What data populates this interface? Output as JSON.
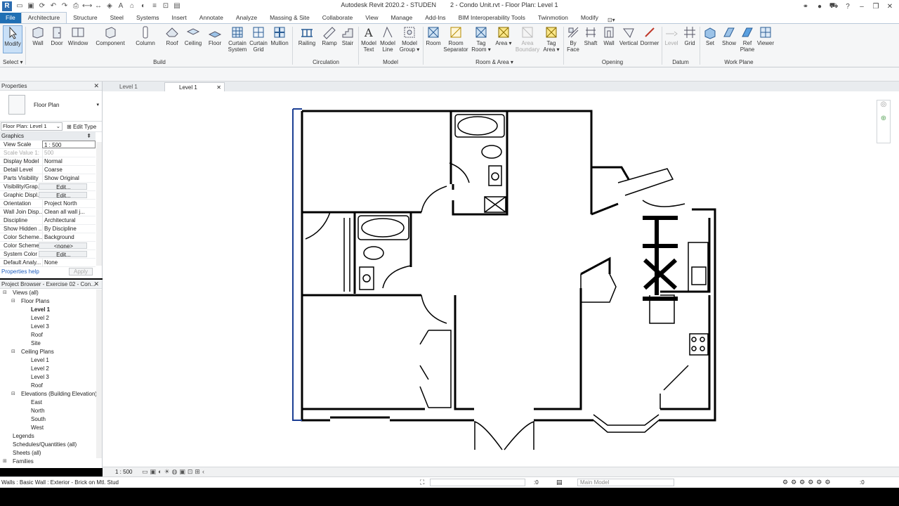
{
  "titlebar": {
    "title": "Autodesk Revit 2020.2 - STUDEN",
    "doc": "2 - Condo Unit.rvt - Floor Plan: Level 1",
    "app_letter": "R"
  },
  "ribbon_tabs": [
    "File",
    "Architecture",
    "Structure",
    "Steel",
    "Systems",
    "Insert",
    "Annotate",
    "Analyze",
    "Massing & Site",
    "Collaborate",
    "View",
    "Manage",
    "Add-Ins",
    "BIM Interoperability Tools",
    "Twinmotion",
    "Modify"
  ],
  "ribbon_active_tab": "Architecture",
  "tools": {
    "modify": "Modify",
    "wall": "Wall",
    "door": "Door",
    "window": "Window",
    "component": "Component",
    "column": "Column",
    "roof": "Roof",
    "ceiling": "Ceiling",
    "floor": "Floor",
    "curtain_system_1": "Curtain",
    "curtain_system_2": "System",
    "curtain_grid_1": "Curtain",
    "curtain_grid_2": "Grid",
    "mullion": "Mullion",
    "railing": "Railing",
    "ramp": "Ramp",
    "stair": "Stair",
    "model_text_1": "Model",
    "model_text_2": "Text",
    "model_line_1": "Model",
    "model_line_2": "Line",
    "model_group_1": "Model",
    "model_group_2": "Group",
    "room": "Room",
    "room_sep_1": "Room",
    "room_sep_2": "Separator",
    "tag_room_1": "Tag",
    "tag_room_2": "Room",
    "area": "Area",
    "area_boundary_1": "Area",
    "area_boundary_2": "Boundary",
    "tag_area_1": "Tag",
    "tag_area_2": "Area",
    "by_face_1": "By",
    "by_face_2": "Face",
    "shaft": "Shaft",
    "wall_opening": "Wall",
    "vertical": "Vertical",
    "dormer": "Dormer",
    "level": "Level",
    "grid": "Grid",
    "set": "Set",
    "show": "Show",
    "ref_plane_1": "Ref",
    "ref_plane_2": "Plane",
    "viewer": "Viewer"
  },
  "groups": {
    "select": "Select",
    "build": "Build",
    "circulation": "Circulation",
    "model": "Model",
    "room_area": "Room & Area",
    "opening": "Opening",
    "datum": "Datum",
    "work_plane": "Work Plane"
  },
  "properties": {
    "title": "Properties",
    "type_name": "Floor Plan",
    "instance": "Floor Plan: Level 1",
    "edit_type": "Edit Type",
    "section": "Graphics",
    "rows": [
      {
        "k": "View Scale",
        "v": "1 : 500"
      },
      {
        "k": "Scale Value    1:",
        "v": "500"
      },
      {
        "k": "Display Model",
        "v": "Normal"
      },
      {
        "k": "Detail Level",
        "v": "Coarse"
      },
      {
        "k": "Parts Visibility",
        "v": "Show Original"
      },
      {
        "k": "Visibility/Grap...",
        "v": "Edit..."
      },
      {
        "k": "Graphic Displ...",
        "v": "Edit..."
      },
      {
        "k": "Orientation",
        "v": "Project North"
      },
      {
        "k": "Wall Join Disp...",
        "v": "Clean all wall j..."
      },
      {
        "k": "Discipline",
        "v": "Architectural"
      },
      {
        "k": "Show Hidden ...",
        "v": "By Discipline"
      },
      {
        "k": "Color Scheme...",
        "v": "Background"
      },
      {
        "k": "Color Scheme",
        "v": "<none>"
      },
      {
        "k": "System Color ...",
        "v": "Edit..."
      },
      {
        "k": "Default Analy...",
        "v": "None"
      }
    ],
    "help": "Properties help",
    "apply": "Apply"
  },
  "browser": {
    "title": "Project Browser - Exercise 02 - Con...",
    "items": [
      {
        "label": "Views (all)",
        "level": 0,
        "toggle": "−"
      },
      {
        "label": "Floor Plans",
        "level": 1,
        "toggle": "−"
      },
      {
        "label": "Level 1",
        "level": 2,
        "bold": true
      },
      {
        "label": "Level 2",
        "level": 2
      },
      {
        "label": "Level 3",
        "level": 2
      },
      {
        "label": "Roof",
        "level": 2
      },
      {
        "label": "Site",
        "level": 2
      },
      {
        "label": "Ceiling Plans",
        "level": 1,
        "toggle": "−"
      },
      {
        "label": "Level 1",
        "level": 2
      },
      {
        "label": "Level 2",
        "level": 2
      },
      {
        "label": "Level 3",
        "level": 2
      },
      {
        "label": "Roof",
        "level": 2
      },
      {
        "label": "Elevations (Building Elevation)",
        "level": 1,
        "toggle": "−"
      },
      {
        "label": "East",
        "level": 2
      },
      {
        "label": "North",
        "level": 2
      },
      {
        "label": "South",
        "level": 2
      },
      {
        "label": "West",
        "level": 2
      },
      {
        "label": "Legends",
        "level": 0
      },
      {
        "label": "Schedules/Quantities (all)",
        "level": 0
      },
      {
        "label": "Sheets (all)",
        "level": 0
      },
      {
        "label": "Families",
        "level": 0,
        "toggle": "+"
      }
    ]
  },
  "view_tabs": [
    "Level 1",
    "Level 1"
  ],
  "view_bar": {
    "scale": "1 : 500"
  },
  "status": {
    "message": "Walls : Basic Wall : Exterior - Brick on Mtl. Stud",
    "count": ":0",
    "model": "Main Model",
    "filter": ":0"
  },
  "colors": {
    "accent": "#1f6fb4",
    "wall": "#000000",
    "selected_wall": "#1c3f94"
  }
}
